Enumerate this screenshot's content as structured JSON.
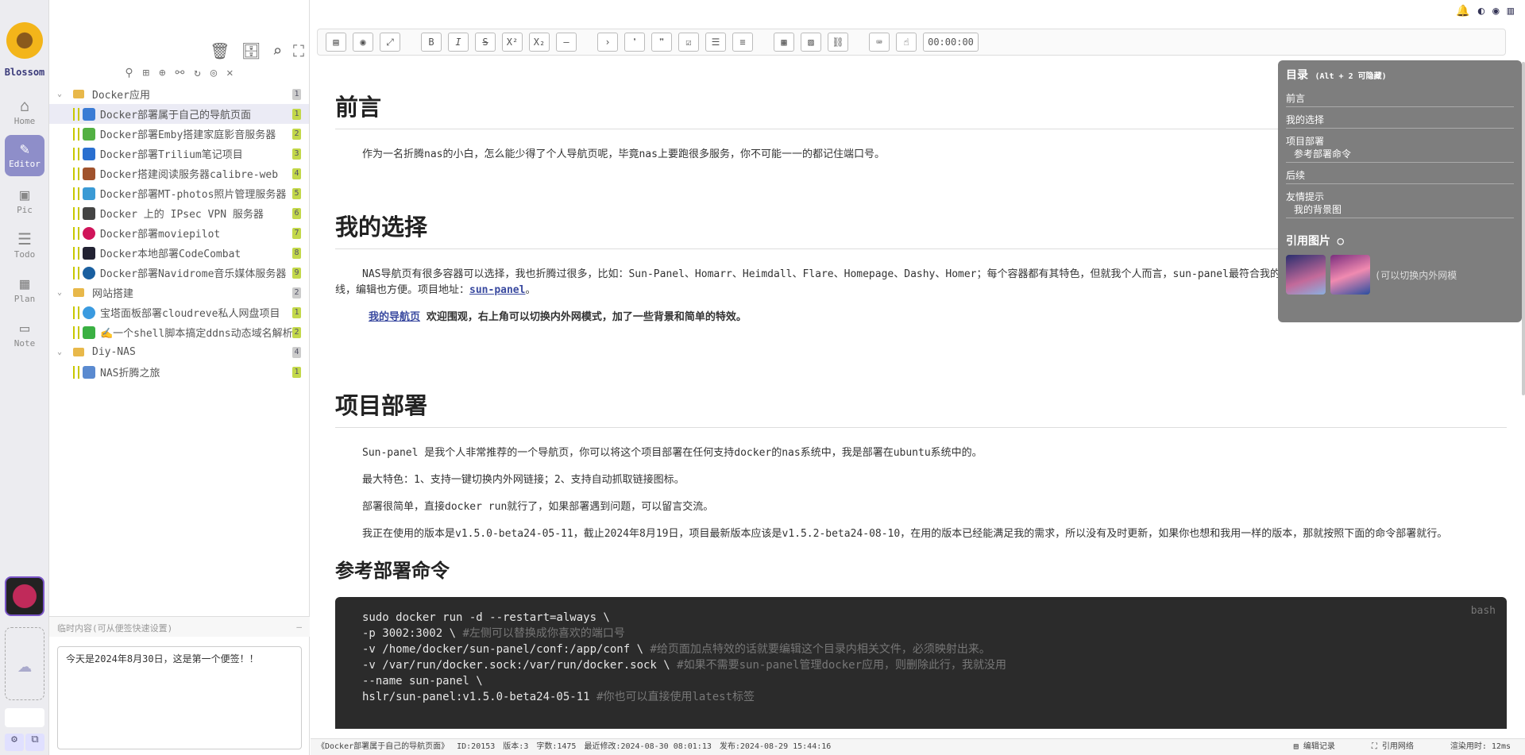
{
  "rail": {
    "logo_label": "Blossom",
    "items": [
      {
        "label": "Home",
        "icon": "⌂"
      },
      {
        "label": "Editor",
        "icon": "✎"
      },
      {
        "label": "Pic",
        "icon": "▣"
      },
      {
        "label": "Todo",
        "icon": "☰"
      },
      {
        "label": "Plan",
        "icon": "▦"
      },
      {
        "label": "Note",
        "icon": "▭"
      }
    ]
  },
  "tree": {
    "nodes": [
      {
        "type": "folder",
        "label": "Docker应用",
        "count": "1"
      },
      {
        "type": "doc",
        "label": "Docker部署属于自己的导航页面",
        "count": "1",
        "color": "#3a7bd5"
      },
      {
        "type": "doc",
        "label": "Docker部署Emby搭建家庭影音服务器",
        "count": "2",
        "color": "#52b043"
      },
      {
        "type": "doc",
        "label": "Docker部署Trilium笔记项目",
        "count": "3",
        "color": "#2a6fd0"
      },
      {
        "type": "doc",
        "label": "Docker搭建阅读服务器calibre-web",
        "count": "4",
        "color": "#a0522d"
      },
      {
        "type": "doc",
        "label": "Docker部署MT-photos照片管理服务器",
        "count": "5",
        "color": "#3a9ad5"
      },
      {
        "type": "doc",
        "label": "Docker 上的 IPsec VPN 服务器",
        "count": "6",
        "color": "#444"
      },
      {
        "type": "doc",
        "label": "Docker部署moviepilot",
        "count": "7",
        "color": "#d0145a"
      },
      {
        "type": "doc",
        "label": "Docker本地部署CodeCombat",
        "count": "8",
        "color": "#223"
      },
      {
        "type": "doc",
        "label": "Docker部署Navidrome音乐媒体服务器",
        "count": "9",
        "color": "#1a5fa0"
      },
      {
        "type": "folder",
        "label": "网站搭建",
        "count": "2"
      },
      {
        "type": "doc",
        "label": "宝塔面板部署cloudreve私人网盘项目",
        "count": "1",
        "color": "#3a9ae0"
      },
      {
        "type": "doc",
        "label": "✍️一个shell脚本搞定ddns动态域名解析",
        "count": "2",
        "color": "#3ab043"
      },
      {
        "type": "folder",
        "label": "Diy-NAS",
        "count": "4"
      },
      {
        "type": "doc",
        "label": "NAS折腾之旅",
        "count": "1",
        "color": "#5a8ad0"
      }
    ],
    "memo_title": "临时内容(可从便签快速设置)",
    "memo_text": "今天是2024年8月30日，这是第一个便签！！"
  },
  "toolbar": {
    "timer": "00:00:00"
  },
  "doc": {
    "h1_preface": "前言",
    "p_preface": "作为一名折腾nas的小白，怎么能少得了个人导航页呢，毕竟nas上要跑很多服务，你不可能一一的都记住端口号。",
    "h1_choice": "我的选择",
    "p_choice": "NAS导航页有很多容器可以选择，我也折腾过很多，比如：Sun-Panel、Homarr、Heimdall、Flare、Homepage、Dashy、Homer；每个容器都有其特色，但就我个人而言，sun-panel最符合我的使用习惯（可以切换内外网模式），而且颜值也在线，编辑也方便。项目地址：",
    "link_sunpanel": "sun-panel",
    "link_mynav": "我的导航页",
    "p_mynav": " 欢迎围观，右上角可以切换内外网模式，加了一些背景和简单的特效。",
    "h1_deploy": "项目部署",
    "p_deploy1": "Sun-panel 是我个人非常推荐的一个导航页，你可以将这个项目部署在任何支持docker的nas系统中，我是部署在ubuntu系统中的。",
    "p_deploy2": "最大特色：1、支持一键切换内外网链接；2、支持自动抓取链接图标。",
    "p_deploy3": "部署很简单，直接docker run就行了，如果部署遇到问题，可以留言交流。",
    "p_deploy4": "我正在使用的版本是v1.5.0-beta24-05-11，截止2024年8月19日，项目最新版本应该是v1.5.2-beta24-08-10，在用的版本已经能满足我的需求，所以没有及时更新，如果你也想和我用一样的版本，那就按照下面的命令部署就行。",
    "h2_cmd": "参考部署命令",
    "code_lang": "bash",
    "code_lines": [
      {
        "code": "sudo docker run -d --restart=always \\",
        "comment": ""
      },
      {
        "code": "-p 3002:3002 \\ ",
        "comment": "#左侧可以替换成你喜欢的端口号"
      },
      {
        "code": "-v /home/docker/sun-panel/conf:/app/conf \\ ",
        "comment": "#给页面加点特效的话就要编辑这个目录内相关文件，必须映射出来。"
      },
      {
        "code": "-v /var/run/docker.sock:/var/run/docker.sock \\  ",
        "comment": "#如果不需要sun-panel管理docker应用，则删除此行，我就没用"
      },
      {
        "code": "--name sun-panel \\",
        "comment": ""
      },
      {
        "code": "hslr/sun-panel:v1.5.0-beta24-05-11 ",
        "comment": "#你也可以直接使用latest标签"
      }
    ]
  },
  "toc": {
    "title": "目录",
    "hint": "(Alt + 2 可隐藏)",
    "items": [
      {
        "label": "前言",
        "sub": []
      },
      {
        "label": "我的选择",
        "sub": []
      },
      {
        "label": "项目部署",
        "sub": [
          "参考部署命令"
        ]
      },
      {
        "label": "后续",
        "sub": []
      },
      {
        "label": "友情提示",
        "sub": [
          "我的背景图"
        ]
      }
    ],
    "ref_title": "引用图片",
    "ref_caption": "(可以切换内外网模"
  },
  "status": {
    "doc_title": "《Docker部署属于自己的导航页面》",
    "id": "ID:20153",
    "version": "版本:3",
    "words": "字数:1475",
    "modified": "最近修改:2024-08-30 08:01:13",
    "published": "发布:2024-08-29 15:44:16",
    "edit_log": "编辑记录",
    "net": "引用网络",
    "render": "渲染用时: 12ms"
  }
}
